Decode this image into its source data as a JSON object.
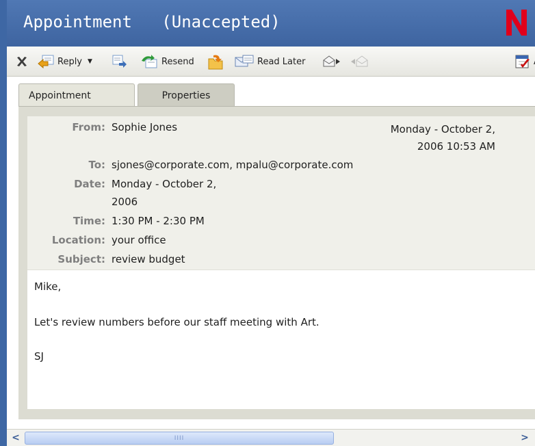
{
  "window": {
    "title": "Appointment   (Unaccepted)",
    "brand_letter": "N",
    "brand_color": "#e0001b",
    "titlebar_color": "#4a70ae"
  },
  "toolbar": {
    "items": [
      {
        "name": "delete",
        "label": ""
      },
      {
        "name": "reply",
        "label": "Reply",
        "has_dropdown": true
      },
      {
        "name": "forward",
        "label": ""
      },
      {
        "name": "resend",
        "label": "Resend"
      },
      {
        "name": "move",
        "label": ""
      },
      {
        "name": "read-later",
        "label": "Read Later"
      },
      {
        "name": "next",
        "label": ""
      },
      {
        "name": "previous",
        "label": ""
      },
      {
        "name": "accept",
        "label": "A"
      }
    ]
  },
  "tabs": [
    {
      "label": "Appointment",
      "active": true
    },
    {
      "label": "Properties",
      "active": false
    }
  ],
  "header": {
    "from_label": "From:",
    "from_value": "Sophie Jones",
    "sent_line1": "Monday - October 2,",
    "sent_line2": "2006 10:53 AM",
    "to_label": "To:",
    "to_value": "sjones@corporate.com, mpalu@corporate.com",
    "date_label": "Date:",
    "date_line1": "Monday - October 2,",
    "date_line2": "2006",
    "time_label": "Time:",
    "time_value": "1:30 PM - 2:30 PM",
    "location_label": "Location:",
    "location_value": "your office",
    "subject_label": "Subject:",
    "subject_value": "review budget"
  },
  "message": {
    "lines": [
      "Mike,",
      "Let's review numbers before our staff meeting with Art.",
      "SJ"
    ]
  },
  "scrollbar": {
    "left_arrow": "<",
    "right_arrow": ">",
    "grip": "IIII"
  }
}
